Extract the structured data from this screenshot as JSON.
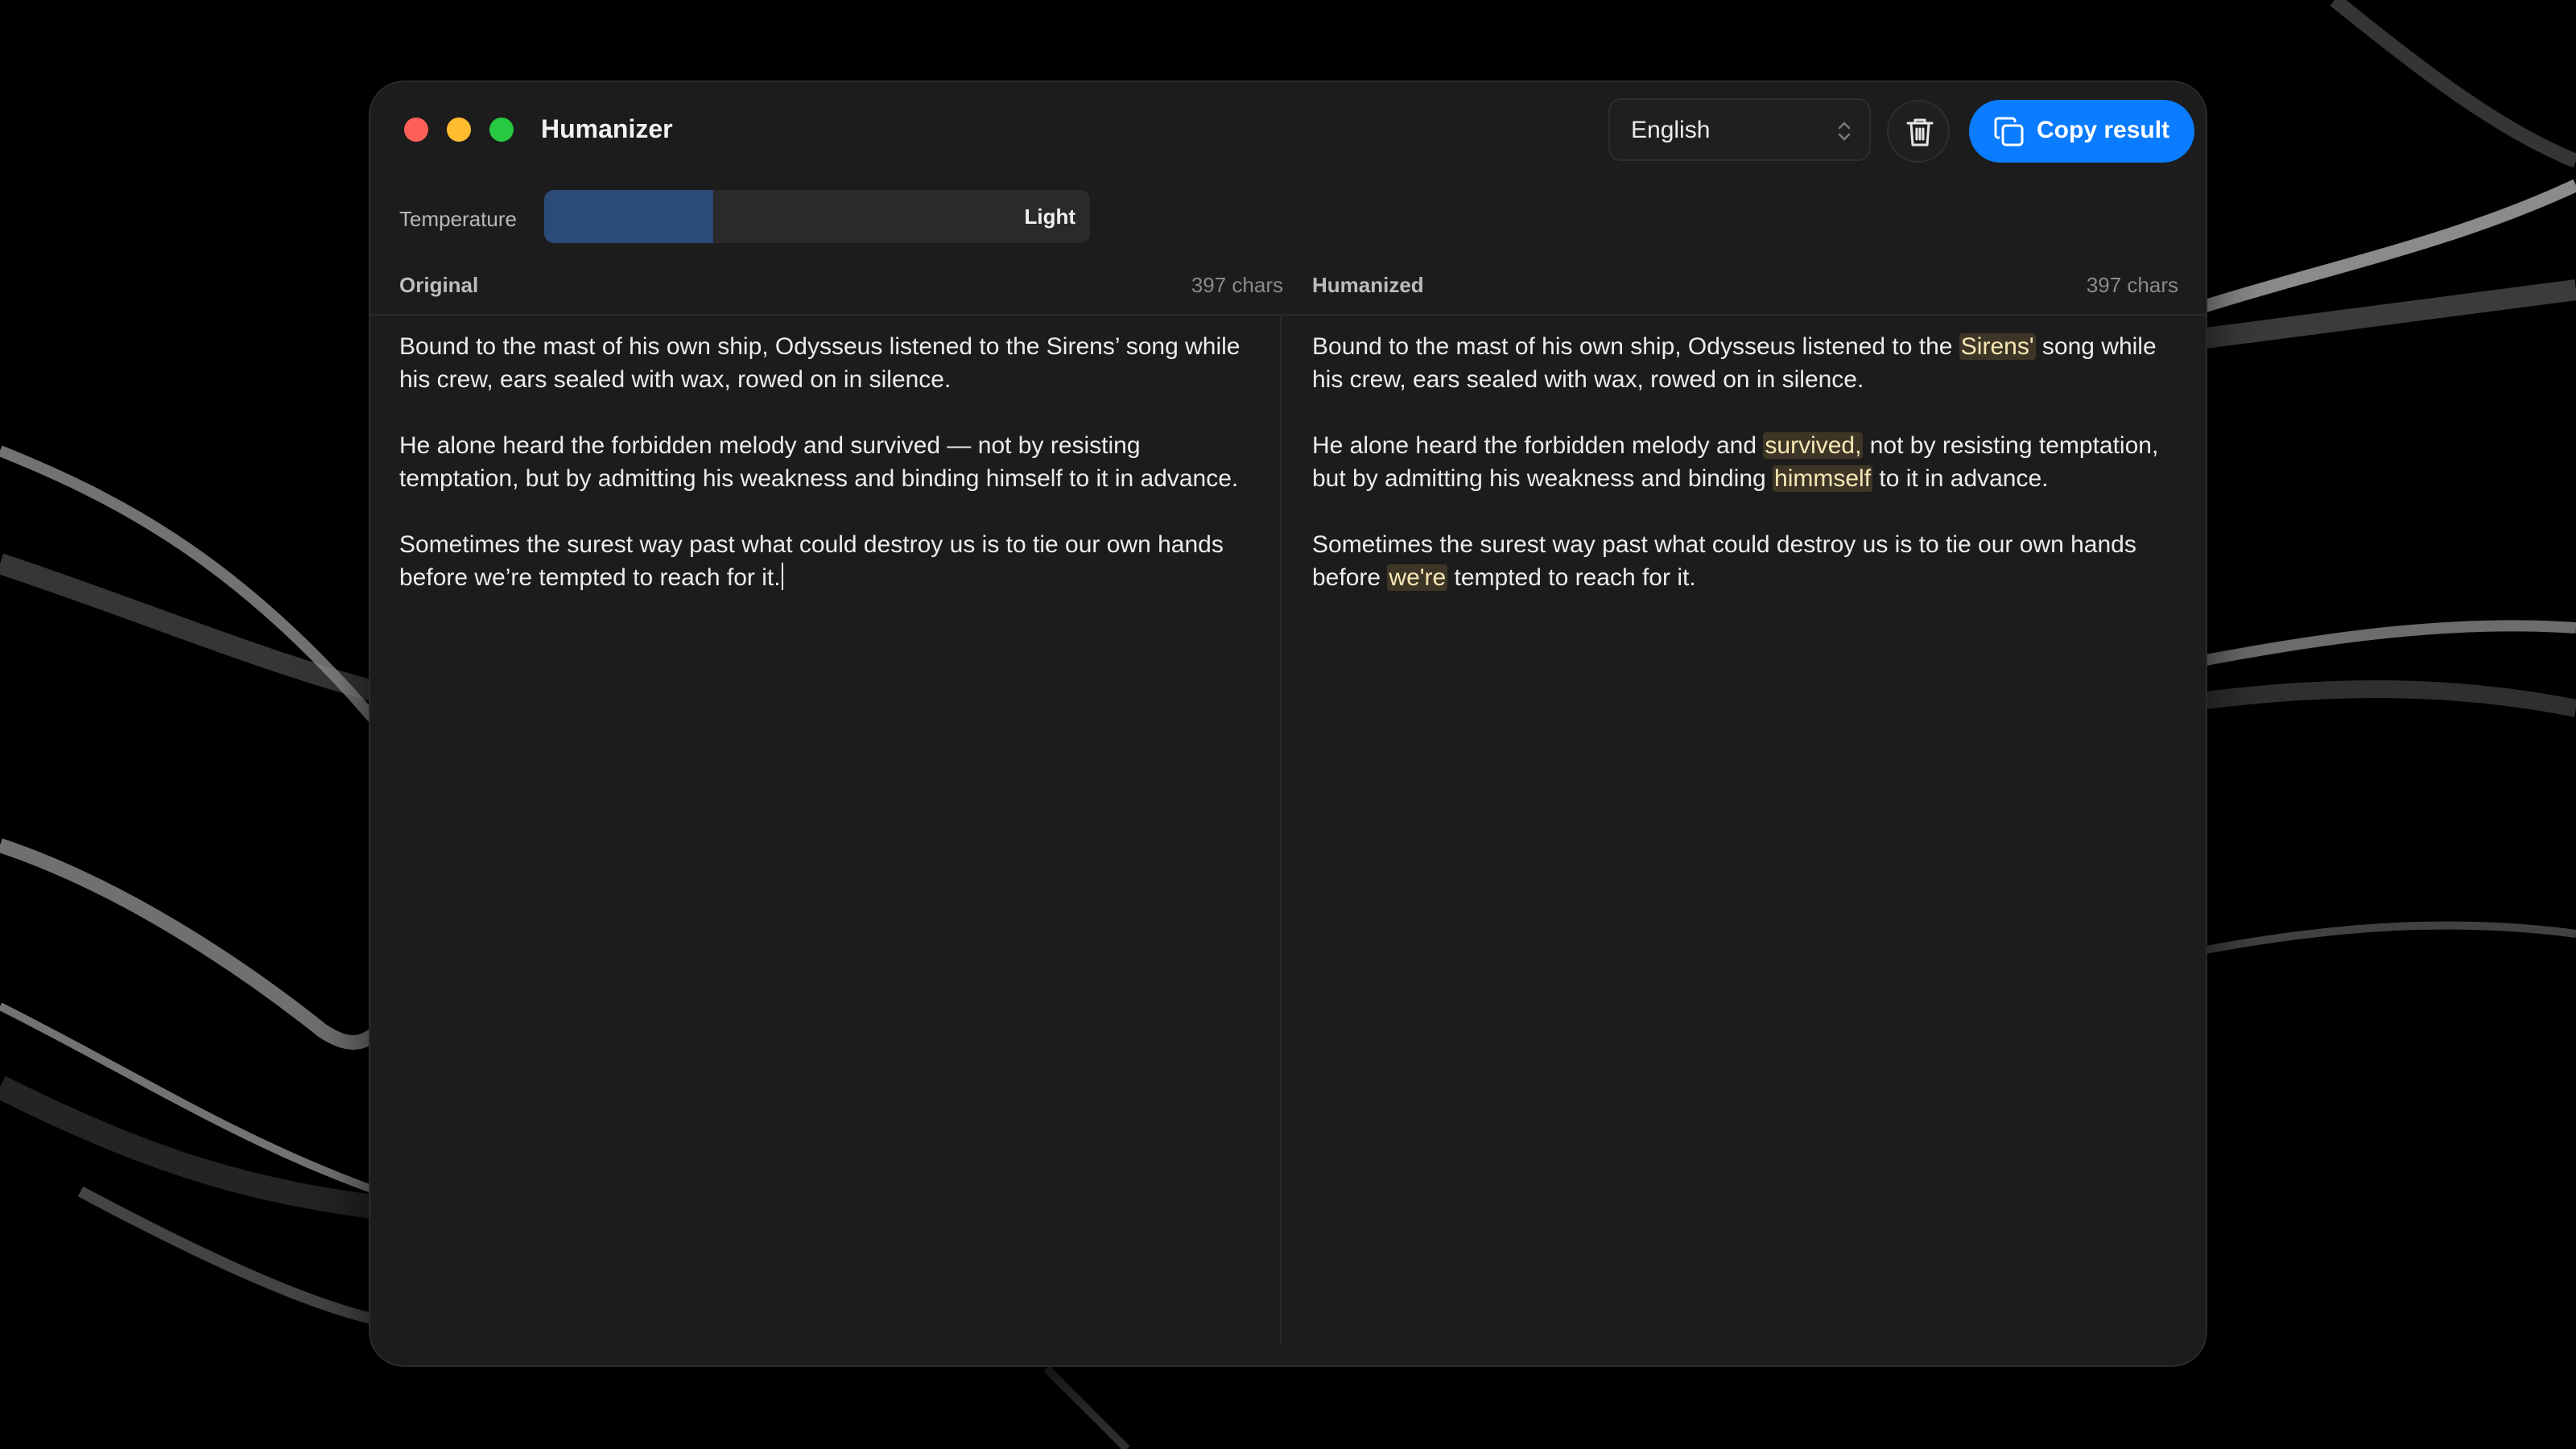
{
  "app": {
    "title": "Humanizer",
    "language": "English",
    "copy_label": "Copy result"
  },
  "temperature": {
    "label": "Temperature",
    "value_label": "Light",
    "level_fraction": 0.31
  },
  "original": {
    "heading": "Original",
    "count": "397 chars",
    "paragraphs": [
      "Bound to the mast of his own ship, Odysseus listened to the Sirens’ song while his crew, ears sealed with wax, rowed on in silence.",
      "He alone heard the forbidden melody and survived — not by resisting temptation, but by admitting his weakness and binding himself to it in advance.",
      "Sometimes the surest way past what could destroy us is to tie our own hands before we’re tempted to reach for it."
    ]
  },
  "humanized": {
    "heading": "Humanized",
    "count": "397 chars",
    "p1": {
      "pre": "Bound to the mast of his own ship, Odysseus listened to the ",
      "hl": "Sirens'",
      "post": " song while his crew, ears sealed with wax, rowed on in silence."
    },
    "p2": {
      "pre": "He alone heard the forbidden melody and ",
      "hl1": "survived,",
      "mid": " not by resisting temptation, but by admitting his weakness and binding ",
      "hl2": "himmself",
      "post": " to it in advance."
    },
    "p3": {
      "pre": "Sometimes the surest way past what could destroy us is to tie our own hands before ",
      "hl": "we're",
      "post": " tempted to reach for it."
    }
  },
  "colors": {
    "accent": "#0a7cff",
    "highlight_bg": "#3d3626",
    "temperature_fill": "#2c4a78"
  },
  "icons": [
    "close-icon",
    "minimize-icon",
    "zoom-icon",
    "chevron-updown-icon",
    "trash-icon",
    "copy-icon"
  ]
}
